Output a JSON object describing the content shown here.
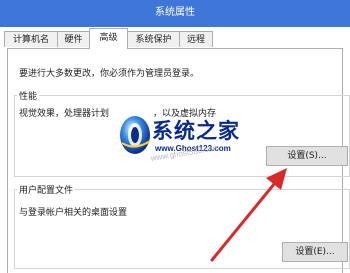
{
  "window": {
    "title": "系统属性",
    "titlebar_color": "#3f77d8"
  },
  "tabs": [
    {
      "label": "计算机名",
      "active": false
    },
    {
      "label": "硬件",
      "active": false
    },
    {
      "label": "高级",
      "active": true
    },
    {
      "label": "系统保护",
      "active": false
    },
    {
      "label": "远程",
      "active": false
    }
  ],
  "advanced": {
    "intro": "要进行大多数更改，你必须作为管理员登录。",
    "performance": {
      "group_label": "性能",
      "description_left": "视觉效果，处理器计划",
      "description_right": "，以及虚拟内存",
      "settings_button": "设置(S)..."
    },
    "user_profiles": {
      "group_label": "用户配置文件",
      "description": "与登录帐户相关的桌面设置",
      "settings_button": "设置(E)..."
    }
  },
  "watermark": {
    "logo_text": "系统之家",
    "url_main": "www.Ghost123.com",
    "url_faint": "www.ghost580.com",
    "logo_color": "#0a2a8a"
  },
  "annotation": {
    "arrow_color": "#d92a2a",
    "arrow_icon": "red-arrow-annotation"
  }
}
